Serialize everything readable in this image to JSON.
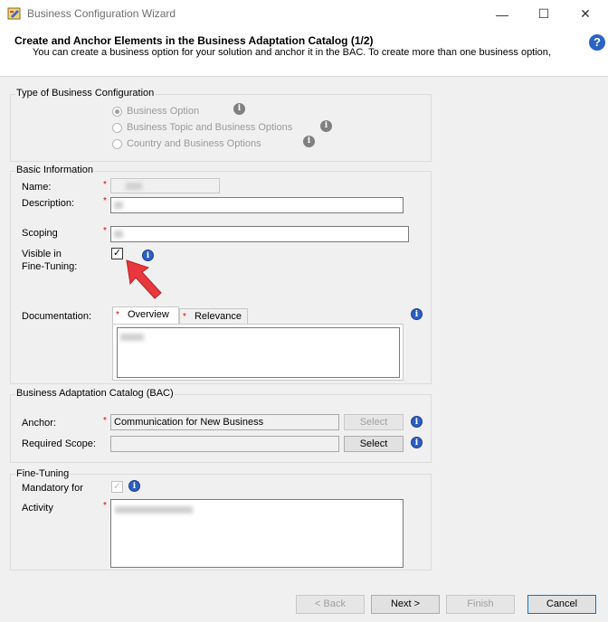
{
  "window": {
    "title": "Business Configuration Wizard",
    "minimize_glyph": "—",
    "maximize_glyph": "☐",
    "close_glyph": "✕"
  },
  "header": {
    "title": "Create and Anchor Elements in the Business Adaptation Catalog (1/2)",
    "description": "You can create a business option for your solution and anchor it in the BAC. To create more than one business option,",
    "help_glyph": "?"
  },
  "type_group": {
    "label": "Type of Business Configuration",
    "options": [
      {
        "label": "Business Option",
        "selected": true
      },
      {
        "label": "Business Topic and Business Options",
        "selected": false
      },
      {
        "label": "Country and Business Options",
        "selected": false
      }
    ]
  },
  "basic_info": {
    "label": "Basic Information",
    "name_label": "Name:",
    "description_label": "Description:",
    "scoping_label": "Scoping",
    "visible_label_1": "Visible in",
    "visible_label_2": "Fine-Tuning:",
    "visible_checked": true,
    "documentation_label": "Documentation:",
    "tabs": [
      "Overview",
      "Relevance"
    ],
    "required_mark": "*"
  },
  "bac": {
    "label": "Business Adaptation Catalog (BAC)",
    "anchor_label": "Anchor:",
    "anchor_value": "Communication for New Business",
    "required_scope_label": "Required Scope:",
    "select_label": "Select"
  },
  "fine_tuning": {
    "label": "Fine-Tuning",
    "mandatory_label": "Mandatory  for",
    "activity_label": "Activity"
  },
  "footer": {
    "back_label": "< Back",
    "next_label": "Next >",
    "finish_label": "Finish",
    "cancel_label": "Cancel"
  },
  "icons": {
    "info_glyph": "i",
    "check_glyph": "✓"
  },
  "colors": {
    "info_blue": "#2d5fc0",
    "arrow_red": "#e8383d",
    "primary_border": "#0078d7"
  }
}
